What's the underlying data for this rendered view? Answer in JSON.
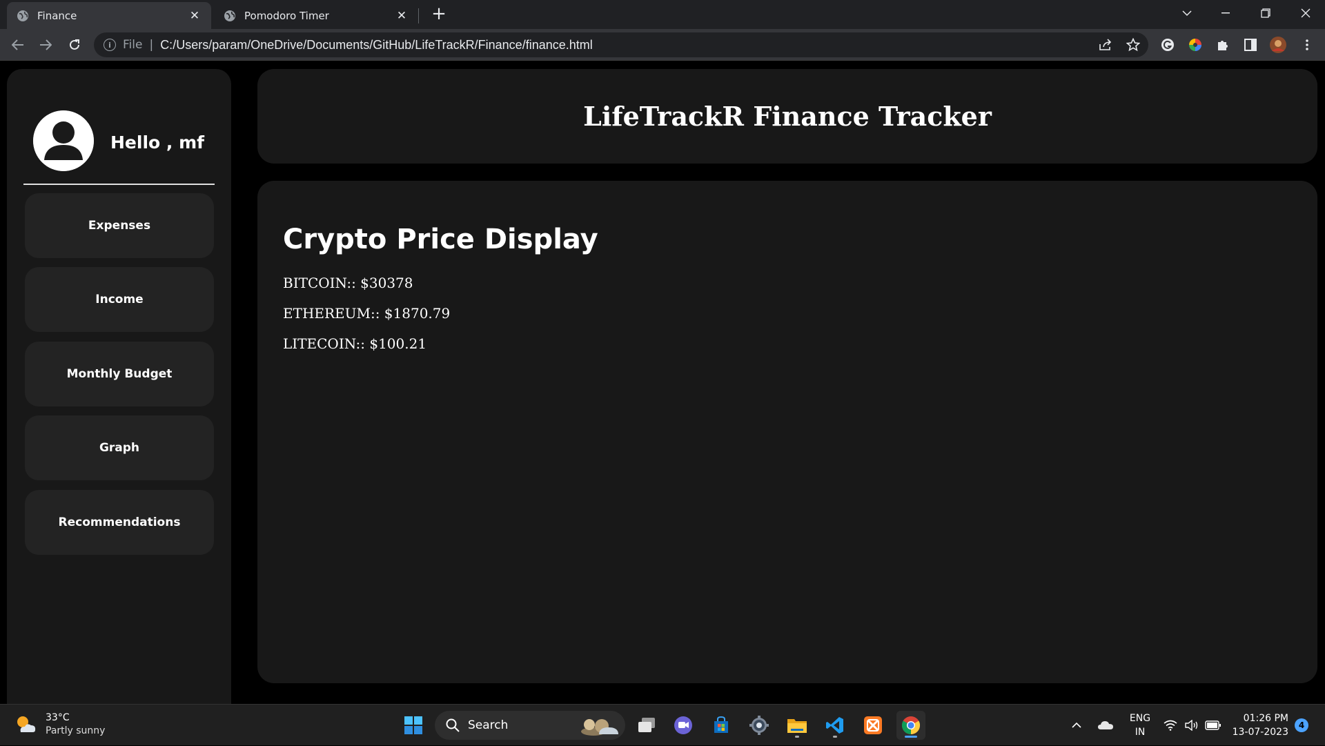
{
  "browser": {
    "tabs": [
      {
        "title": "Finance",
        "active": true
      },
      {
        "title": "Pomodoro Timer",
        "active": false
      }
    ],
    "new_tab": "+",
    "omnibox": {
      "scheme_label": "File",
      "url": "C:/Users/param/OneDrive/Documents/GitHub/LifeTrackR/Finance/finance.html"
    }
  },
  "sidebar": {
    "greeting": "Hello , mf",
    "items": [
      {
        "label": "Expenses"
      },
      {
        "label": "Income"
      },
      {
        "label": "Monthly Budget"
      },
      {
        "label": "Graph"
      },
      {
        "label": "Recommendations"
      }
    ]
  },
  "header": {
    "title": "LifeTrackR Finance Tracker"
  },
  "main": {
    "heading": "Crypto Price Display",
    "prices": [
      {
        "text": "BITCOIN:: $30378"
      },
      {
        "text": "ETHEREUM:: $1870.79"
      },
      {
        "text": "LITECOIN:: $100.21"
      }
    ]
  },
  "taskbar": {
    "weather": {
      "temp": "33°C",
      "condition": "Partly sunny"
    },
    "search_label": "Search",
    "lang": {
      "line1": "ENG",
      "line2": "IN"
    },
    "clock": {
      "time": "01:26 PM",
      "date": "13-07-2023"
    },
    "notification_count": "4"
  },
  "colors": {
    "page_bg": "#000000",
    "card_bg": "#181818",
    "nav_item_bg": "#232323",
    "accent": "#4ca3ff"
  }
}
